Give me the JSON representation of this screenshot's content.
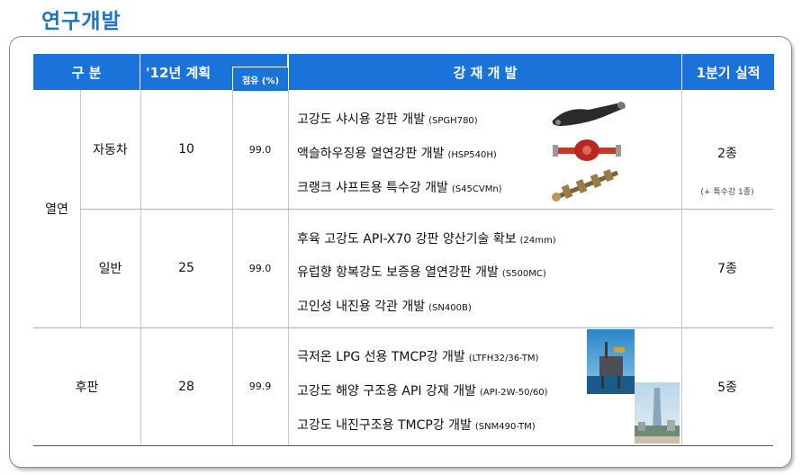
{
  "page_title": "연구개발",
  "header": {
    "category": "구  분",
    "plan": "'12년 계획",
    "share": "점유 (%)",
    "dev": "강  재   개  발",
    "result": "1분기 실적"
  },
  "groups": {
    "hot_rolled": "열연",
    "auto": {
      "label": "자동차",
      "plan": "10",
      "share": "99.0",
      "result": "2종",
      "note": "(+ 특수강 1종)",
      "items": [
        {
          "name": "고강도 샤시용 강판 개발",
          "code": "(SPGH780)"
        },
        {
          "name": "액슬하우징용 열연강판 개발",
          "code": "(HSP540H)"
        },
        {
          "name": "크랭크 샤프트용 특수강 개발",
          "code": "(S45CVMn)"
        }
      ]
    },
    "general": {
      "label": "일반",
      "plan": "25",
      "share": "99.0",
      "result": "7종",
      "items": [
        {
          "name": "후육 고강도 API-X70 강판 양산기술 확보",
          "code": "(24mm)"
        },
        {
          "name": "유럽향 항복강도 보증용 열연강판 개발",
          "code": "(S500MC)"
        },
        {
          "name": "고인성 내진용 각관 개발",
          "code": "(SN400B)"
        }
      ]
    },
    "plate": {
      "label": "후판",
      "plan": "28",
      "share": "99.9",
      "result": "5종",
      "items": [
        {
          "name": "극저온 LPG 선용 TMCP강 개발",
          "code": "(LTFH32/36-TM)"
        },
        {
          "name": "고강도 해양 구조용 API 강재 개발",
          "code": "(API-2W-50/60)"
        },
        {
          "name": "고강도 내진구조용 TMCP강 개발",
          "code": "(SNM490-TM)"
        }
      ]
    }
  },
  "icons": {
    "chassis": "chassis-arm-icon",
    "axle": "axle-housing-icon",
    "crank": "crankshaft-icon",
    "rig": "offshore-rig-photo",
    "tower": "skyscraper-photo"
  }
}
